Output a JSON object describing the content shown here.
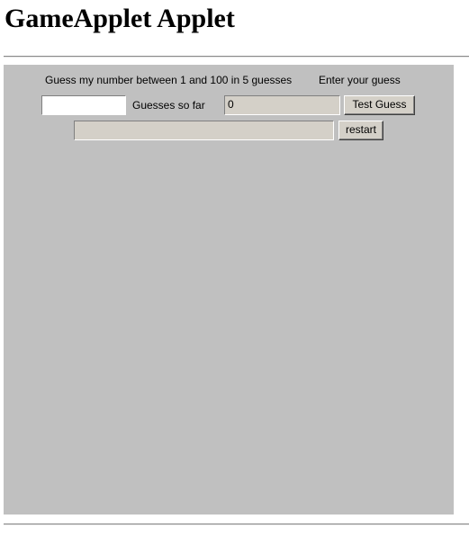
{
  "page": {
    "title": "GameApplet Applet"
  },
  "applet": {
    "instructions": "Guess my number between 1 and 100 in 5 guesses",
    "enter_label": "Enter your guess",
    "guess_input_value": "",
    "guesses_label": "Guesses so far",
    "guesses_value": "0",
    "test_guess_button": "Test Guess",
    "message_value": "",
    "restart_button": "restart"
  },
  "colors": {
    "applet_background": "#c0c0c0",
    "readonly_field": "#d4d0c8",
    "button_face": "#d4d0c8"
  }
}
